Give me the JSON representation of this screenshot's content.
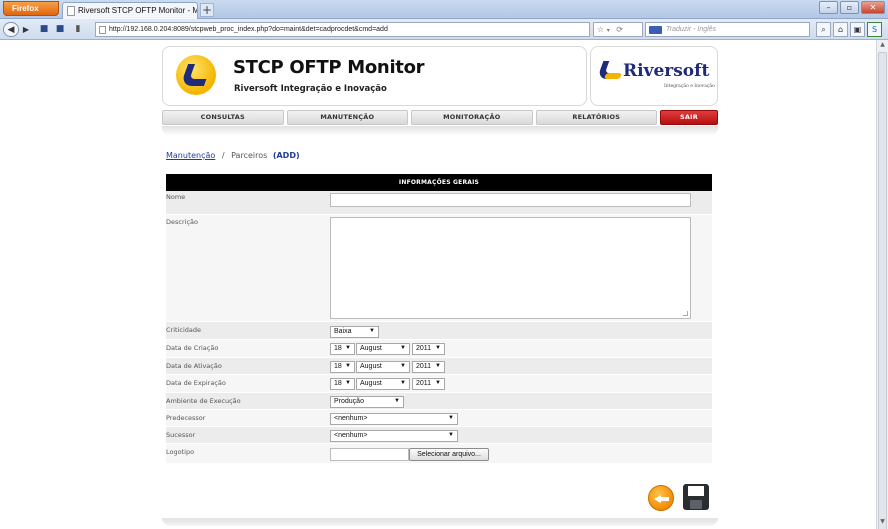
{
  "browser": {
    "menu_button": "Firefox",
    "tab_title": "Riversoft STCP OFTP Monitor - Manuten...",
    "new_tab": "+",
    "url": "http://192.168.0.204:8089/stcpweb_proc_index.php?do=maint&det=cadprocdet&cmd=add",
    "search_placeholder": "Traduzir - Inglês"
  },
  "header": {
    "app_title": "STCP OFTP Monitor",
    "app_subtitle": "Riversoft Integração e Inovação",
    "brand_name": "Riversoft",
    "brand_tagline": "Integração e Inovação"
  },
  "menu": {
    "items": [
      "CONSULTAS",
      "MANUTENÇÃO",
      "MONITORAÇÃO",
      "RELATÓRIOS"
    ],
    "exit": "SAIR"
  },
  "breadcrumb": {
    "link": "Manutenção",
    "separator": "/",
    "current": "Parceiros",
    "mode": "(ADD)"
  },
  "form": {
    "header": "INFORMAÇÕES GERAIS",
    "labels": {
      "nome": "Nome",
      "descricao": "Descrição",
      "criticidade": "Criticidade",
      "data_criacao": "Data de Criação",
      "data_ativacao": "Data de Ativação",
      "data_expiracao": "Data de Expiração",
      "ambiente": "Ambiente de Execução",
      "predecessor": "Predecessor",
      "sucessor": "Sucessor",
      "logotipo": "Logotipo"
    },
    "values": {
      "nome": "",
      "descricao": "",
      "criticidade": "Baixa",
      "data_criacao": {
        "day": "18",
        "month": "August",
        "year": "2011"
      },
      "data_ativacao": {
        "day": "18",
        "month": "August",
        "year": "2011"
      },
      "data_expiracao": {
        "day": "18",
        "month": "August",
        "year": "2011"
      },
      "ambiente": "Produção",
      "predecessor": "<nenhum>",
      "sucessor": "<nenhum>"
    },
    "file_button": "Selecionar arquivo..."
  },
  "colors": {
    "exit_button": "#c81e1e",
    "form_header": "#000000",
    "link": "#1e3c9a",
    "back_button": "#f08a00"
  }
}
